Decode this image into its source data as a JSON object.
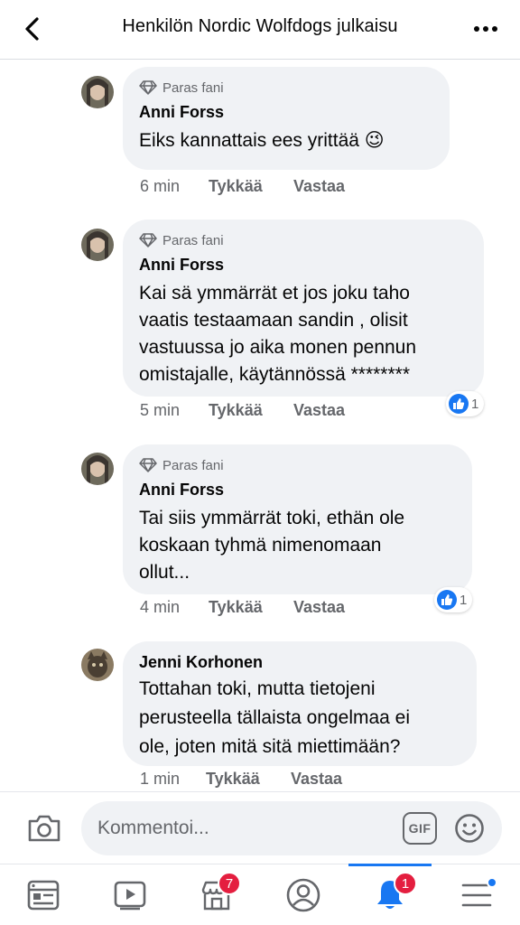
{
  "header": {
    "title": "Henkilön Nordic Wolfdogs julkaisu",
    "back_icon": "chevron-left-icon",
    "more_icon": "more-horizontal-icon"
  },
  "comments": [
    {
      "badge": "Paras fani",
      "author": "Anni Forss",
      "text": "Eiks kannattais ees yrittää 😉",
      "time": "6 min",
      "like_label": "Tykkää",
      "reply_label": "Vastaa",
      "reactions": null
    },
    {
      "badge": "Paras fani",
      "author": "Anni Forss",
      "text": "Kai sä ymmärrät et jos joku taho\nvaatis testaamaan sandin , olisit\nvastuussa jo aika monen pennun\nomistajalle, käytännössä ********",
      "time": "5 min",
      "like_label": "Tykkää",
      "reply_label": "Vastaa",
      "reactions": "1"
    },
    {
      "badge": "Paras fani",
      "author": "Anni Forss",
      "text": "Tai siis ymmärrät toki, ethän ole\nkoskaan tyhmä nimenomaan\nollut...",
      "time": "4 min",
      "like_label": "Tykkää",
      "reply_label": "Vastaa",
      "reactions": "1"
    },
    {
      "badge": "",
      "author": "Jenni Korhonen",
      "text": "Tottahan toki, mutta tietojeni\nperusteella tällaista ongelmaa ei\nole, joten mitä sitä miettimään?",
      "time": "1 min",
      "like_label": "Tykkää",
      "reply_label": "Vastaa",
      "reactions": null
    }
  ],
  "composer": {
    "placeholder": "Kommentoi...",
    "gif_label": "GIF",
    "camera_icon": "camera-icon",
    "emoji_icon": "smiley-icon"
  },
  "tabbar": {
    "tabs": [
      {
        "name": "news-feed",
        "icon": "newsfeed-icon",
        "badge": ""
      },
      {
        "name": "watch",
        "icon": "video-play-icon",
        "badge": ""
      },
      {
        "name": "marketplace",
        "icon": "marketplace-icon",
        "badge": "7"
      },
      {
        "name": "profile",
        "icon": "profile-icon",
        "badge": ""
      },
      {
        "name": "notifications",
        "icon": "bell-icon",
        "badge": "1",
        "active": true
      },
      {
        "name": "menu",
        "icon": "hamburger-menu-icon",
        "badge": ""
      }
    ]
  },
  "colors": {
    "accent": "#1877f2",
    "bubble": "#f0f2f5",
    "secondary_text": "#65676b",
    "badge_red": "#e41e3f"
  }
}
